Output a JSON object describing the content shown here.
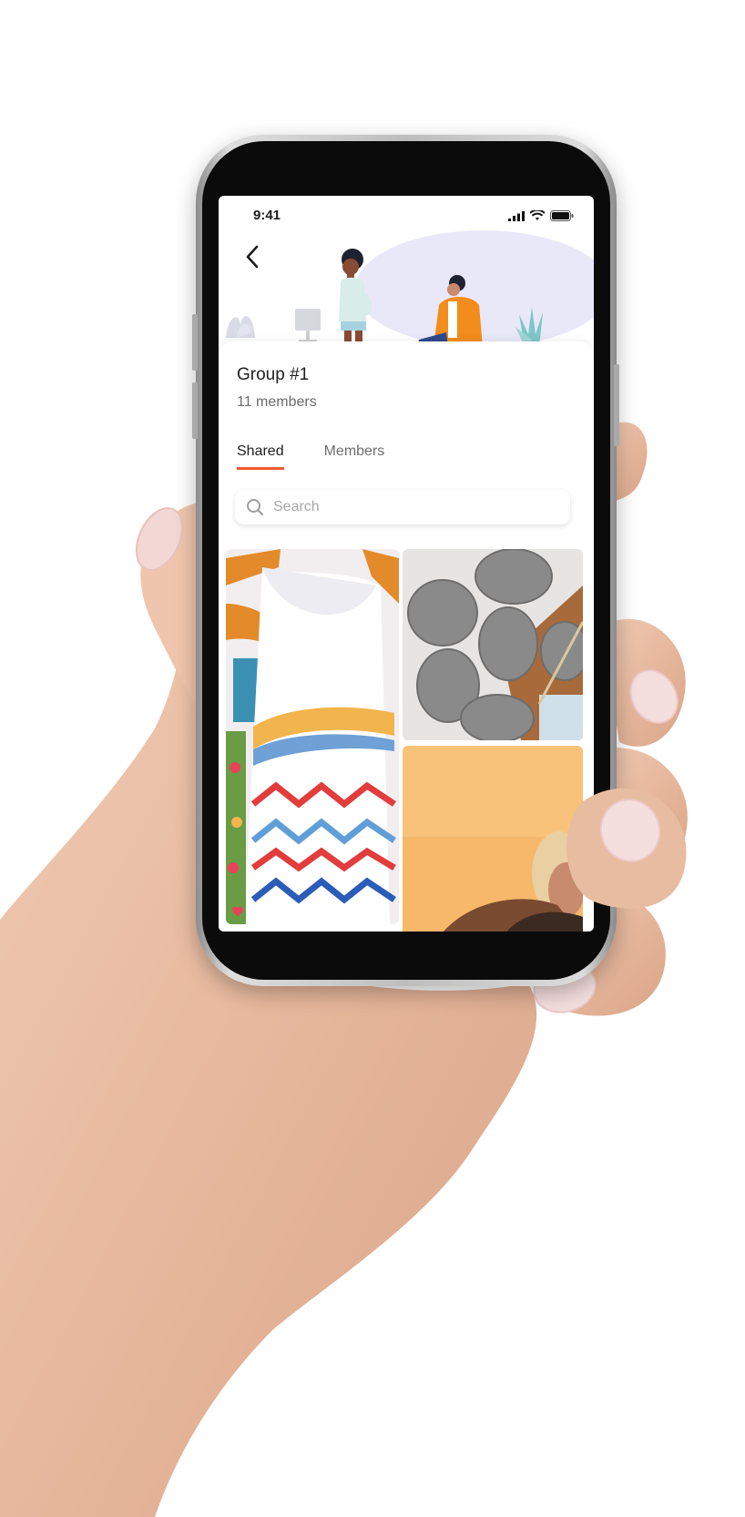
{
  "status_bar": {
    "time": "9:41"
  },
  "group": {
    "title": "Group #1",
    "members_count": "11 members"
  },
  "tabs": [
    {
      "label": "Shared",
      "active": true
    },
    {
      "label": "Members",
      "active": false
    }
  ],
  "search": {
    "placeholder": "Search"
  },
  "icons": {
    "back": "chevron-left-icon",
    "search": "search-icon",
    "heart": "heart-icon",
    "signal": "signal-icon",
    "wifi": "wifi-icon",
    "battery": "battery-icon"
  },
  "colors": {
    "accent": "#ef5a33",
    "hero_blob": "#e9e8f8",
    "heart": "#e8435a"
  },
  "gallery": [
    {
      "name": "clothes-photo",
      "liked": true
    },
    {
      "name": "yarn-photo",
      "liked": false
    },
    {
      "name": "portrait-photo",
      "liked": false
    }
  ]
}
